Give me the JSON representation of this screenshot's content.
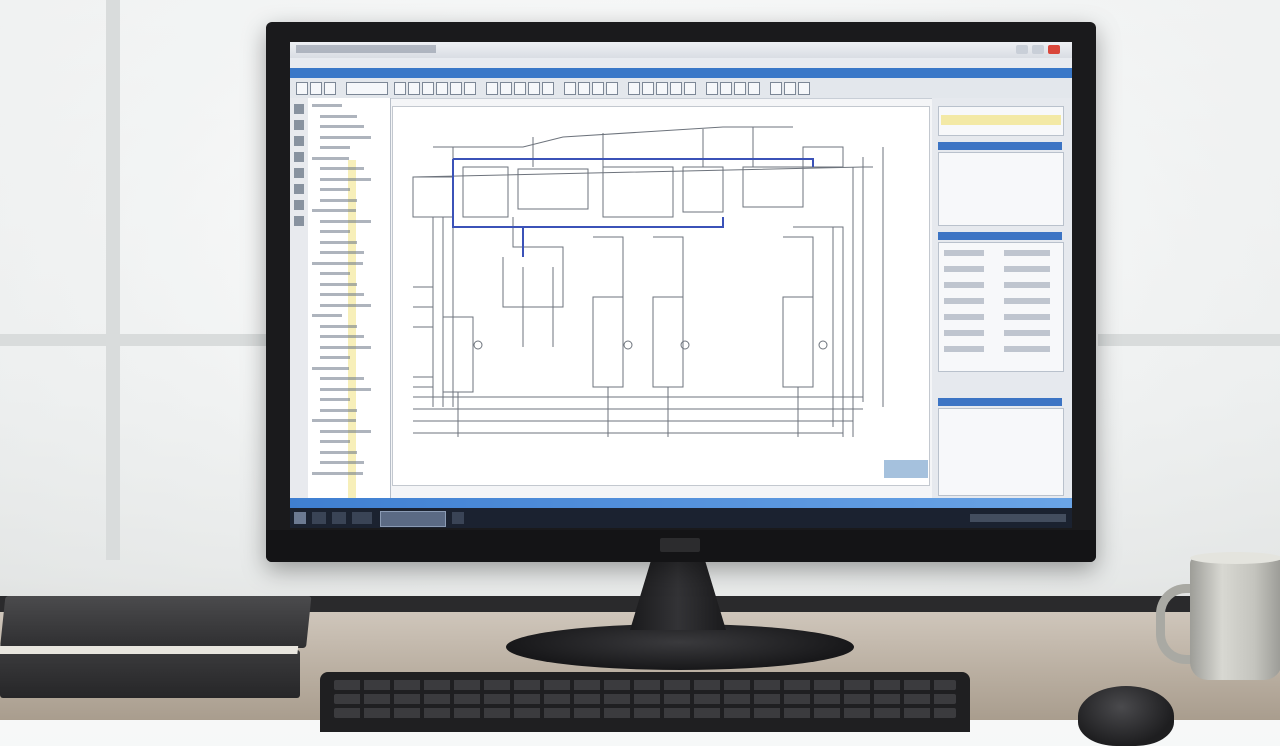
{
  "scene": {
    "description_label": "",
    "colors": {
      "app_blue": "#3a78c8",
      "selection_blue": "#3b52b8",
      "wire": "#6d737c",
      "bezel": "#1a1a1c"
    }
  },
  "screen_app": {
    "schematic": {
      "highlight_color": "#3b52b8",
      "line_color": "#6d737c"
    }
  },
  "icons": {
    "window_close": "close-icon",
    "window_min": "minimize-icon",
    "window_max": "maximize-icon",
    "start": "start-icon"
  }
}
